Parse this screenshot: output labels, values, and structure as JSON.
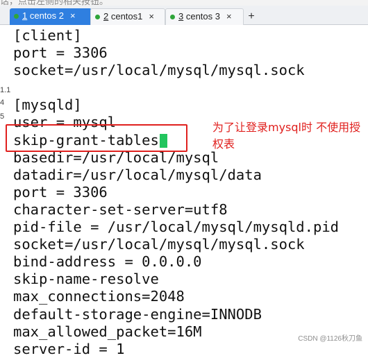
{
  "top_hint": "话，点击左侧的相关按钮。",
  "tabs": [
    {
      "index": "1",
      "label": " centos 2",
      "active": true
    },
    {
      "index": "2",
      "label": " centos1",
      "active": false
    },
    {
      "index": "3",
      "label": " centos 3",
      "active": false
    }
  ],
  "tab_close_glyph": "×",
  "tab_add_glyph": "+",
  "gutter": [
    "1.1",
    "4",
    "5"
  ],
  "editor_lines": [
    "[client]",
    "port = 3306",
    "socket=/usr/local/mysql/mysql.sock",
    "",
    "[mysqld]",
    "user = mysql",
    "skip-grant-tables",
    "basedir=/usr/local/mysql",
    "datadir=/usr/local/mysql/data",
    "port = 3306",
    "character-set-server=utf8",
    "pid-file = /usr/local/mysql/mysqld.pid",
    "socket=/usr/local/mysql/mysql.sock",
    "bind-address = 0.0.0.0",
    "skip-name-resolve",
    "max_connections=2048",
    "default-storage-engine=INNODB",
    "max_allowed_packet=16M",
    "server-id = 1"
  ],
  "annotation": "为了让登录mysql时 不使用授权表",
  "watermark": "CSDN @1126秋刀鱼",
  "colors": {
    "active_tab": "#2f7fe0",
    "status_dot": "#2fa53a",
    "annotation": "#e0201e",
    "cursor": "#22c55e"
  },
  "icons": {
    "close": "close-icon",
    "add": "plus-icon",
    "status": "connected-dot-icon"
  }
}
